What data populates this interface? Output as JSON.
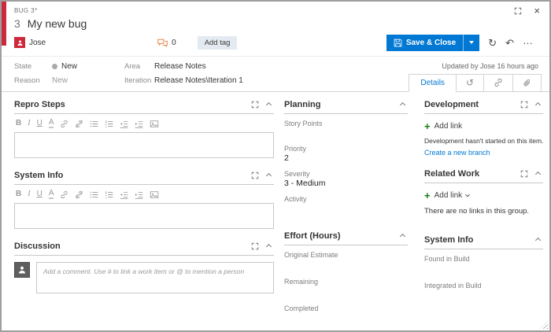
{
  "colors": {
    "accent_blue": "#0078d4",
    "bug_red": "#cc293d",
    "success_green": "#107c10",
    "comment_orange": "#e8722d"
  },
  "window": {
    "type_label": "BUG 3*",
    "id": "3",
    "title": "My new bug",
    "close_glyph": "×"
  },
  "toolbar": {
    "assignee": "Jose",
    "comments_count": "0",
    "add_tag_label": "Add tag",
    "save_label": "Save & Close",
    "refresh_glyph": "↻",
    "undo_glyph": "↶",
    "more_glyph": "…"
  },
  "meta": {
    "state_label": "State",
    "state_value": "New",
    "reason_label": "Reason",
    "reason_value": "New",
    "area_label": "Area",
    "area_value": "Release Notes",
    "iteration_label": "Iteration",
    "iteration_value": "Release Notes\\Iteration 1",
    "updated_text": "Updated by Jose 16 hours ago",
    "details_tab_label": "Details",
    "history_glyph": "↺"
  },
  "editor": {
    "bold": "B",
    "italic": "I",
    "underline": "U",
    "highlight": "A"
  },
  "left": {
    "repro_steps_title": "Repro Steps",
    "system_info_title": "System Info",
    "discussion_title": "Discussion",
    "comment_placeholder": "Add a comment. Use # to link a work item or @ to mention a person"
  },
  "planning": {
    "title": "Planning",
    "fields": [
      {
        "label": "Story Points",
        "value": ""
      },
      {
        "label": "Priority",
        "value": "2"
      },
      {
        "label": "Severity",
        "value": "3 - Medium"
      },
      {
        "label": "Activity",
        "value": ""
      }
    ]
  },
  "effort": {
    "title": "Effort (Hours)",
    "fields": [
      {
        "label": "Original Estimate",
        "value": ""
      },
      {
        "label": "Remaining",
        "value": ""
      },
      {
        "label": "Completed",
        "value": ""
      }
    ]
  },
  "development": {
    "title": "Development",
    "plus_glyph": "+",
    "add_link_label": "Add link",
    "status_text": "Development hasn't started on this item.",
    "branch_link_label": "Create a new branch"
  },
  "related_work": {
    "title": "Related Work",
    "plus_glyph": "+",
    "add_link_label": "Add link",
    "empty_text": "There are no links in this group."
  },
  "system_info_panel": {
    "title": "System Info",
    "fields": [
      {
        "label": "Found in Build",
        "value": ""
      },
      {
        "label": "Integrated in Build",
        "value": ""
      }
    ]
  }
}
